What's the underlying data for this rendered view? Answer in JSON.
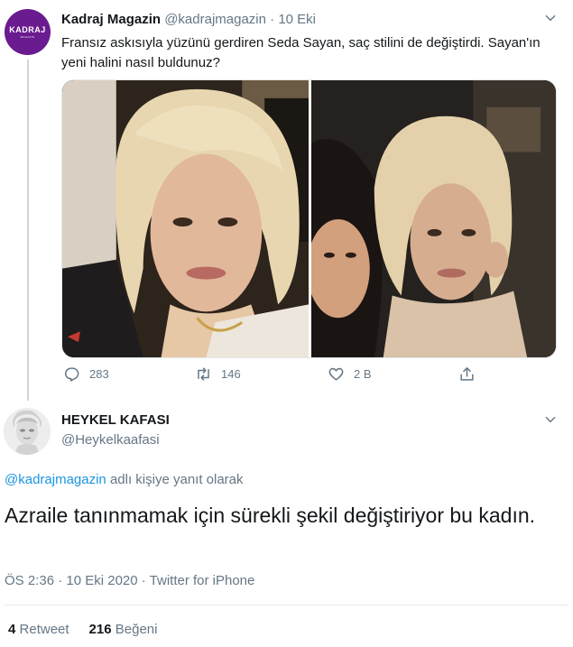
{
  "tweet": {
    "avatar_text": "KADRAJ",
    "avatar_subtext": "MAGAZIN",
    "display_name": "Kadraj Magazin",
    "handle": "@kadrajmagazin",
    "separator": "·",
    "date": "10 Eki",
    "text": "Fransız askısıyla yüzünü gerdiren Seda Sayan, saç stilini de değiştirdi. Sayan'ın yeni halini nasıl buldunuz?",
    "actions": {
      "reply_count": "283",
      "retweet_count": "146",
      "like_count": "2 B"
    },
    "icons": [
      "reply-icon",
      "retweet-icon",
      "like-icon",
      "share-icon",
      "chevron-down-icon"
    ]
  },
  "reply": {
    "display_name": "HEYKEL KAFASI",
    "handle": "@Heykelkaafasi",
    "replying_mention": "@kadrajmagazin",
    "replying_suffix": " adlı kişiye yanıt olarak",
    "text": "Azraile tanınmamak için sürekli şekil değiştiriyor bu kadın.",
    "meta": "ÖS 2:36 · 10 Eki 2020 · Twitter for iPhone",
    "retweets_count": "4",
    "retweets_label": "Retweet",
    "likes_count": "216",
    "likes_label": "Beğeni"
  },
  "colors": {
    "text": "#14171a",
    "muted": "#657786",
    "link": "#1b95e0",
    "avatar_bg": "#6a1b8f",
    "divider": "#e6ecf0"
  }
}
